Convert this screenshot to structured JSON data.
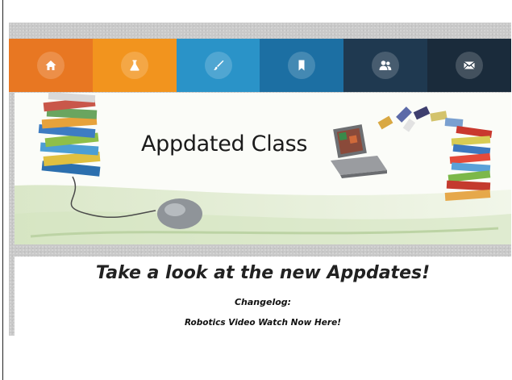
{
  "nav": {
    "tabs": [
      {
        "icon": "home-icon",
        "color": "#e87722"
      },
      {
        "icon": "flask-icon",
        "color": "#f2941e"
      },
      {
        "icon": "brush-icon",
        "color": "#2a93c8"
      },
      {
        "icon": "bookmark-icon",
        "color": "#1c6fa3"
      },
      {
        "icon": "users-icon",
        "color": "#1f3950"
      },
      {
        "icon": "mail-icon",
        "color": "#1a2b3b"
      }
    ]
  },
  "banner": {
    "title": "Appdated Class"
  },
  "content": {
    "headline": "Take a look at the new Appdates!",
    "changelog_label": "Changelog:",
    "link_text": "Robotics Video Watch Now Here!"
  }
}
